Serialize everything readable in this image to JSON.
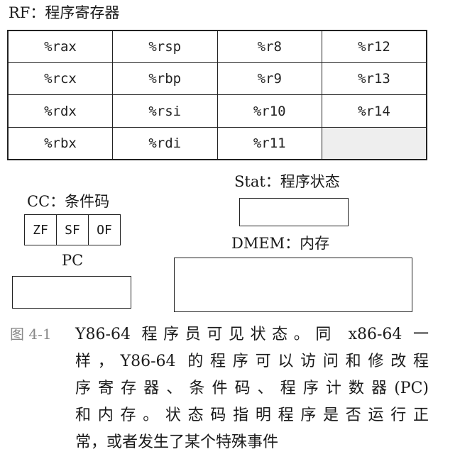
{
  "rf": {
    "label": "RF：程序寄存器",
    "rows": [
      [
        "%rax",
        "%rsp",
        "%r8",
        "%r12"
      ],
      [
        "%rcx",
        "%rbp",
        "%r9",
        "%r13"
      ],
      [
        "%rdx",
        "%rsi",
        "%r10",
        "%r14"
      ],
      [
        "%rbx",
        "%rdi",
        "%r11",
        ""
      ]
    ]
  },
  "cc": {
    "label": "CC：条件码",
    "flags": [
      "ZF",
      "SF",
      "OF"
    ]
  },
  "pc": {
    "label": "PC"
  },
  "stat": {
    "label": "Stat：程序状态"
  },
  "dmem": {
    "label": "DMEM：内存"
  },
  "figure": {
    "number": "图 4-1",
    "caption_lines": [
      "Y86-64 程序员可见状态。同 x86-64 一",
      "样，Y86-64 的程序可以访问和修改程",
      "序寄存器、条件码、程序计数器(PC)",
      "和内存。状态码指明程序是否运行正",
      "常，或者发生了某个特殊事件"
    ]
  }
}
